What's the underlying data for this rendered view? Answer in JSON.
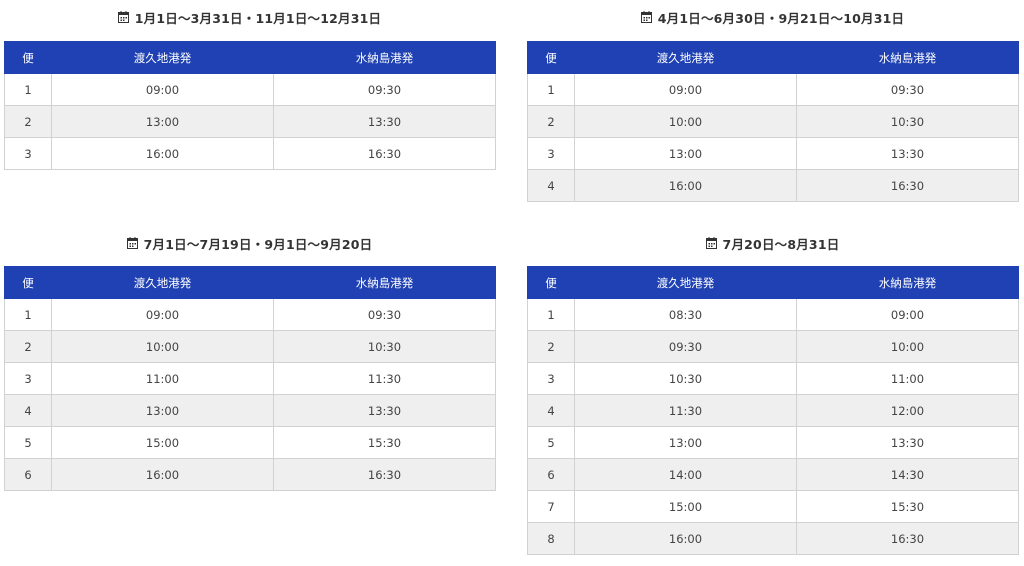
{
  "headers": {
    "col1": "便",
    "col2": "渡久地港発",
    "col3": "水納島港発"
  },
  "panels": [
    {
      "title": "1月1日～3月31日・11月1日～12月31日",
      "rows": [
        {
          "no": "1",
          "a": "09:00",
          "b": "09:30"
        },
        {
          "no": "2",
          "a": "13:00",
          "b": "13:30"
        },
        {
          "no": "3",
          "a": "16:00",
          "b": "16:30"
        }
      ]
    },
    {
      "title": "4月1日～6月30日・9月21日～10月31日",
      "rows": [
        {
          "no": "1",
          "a": "09:00",
          "b": "09:30"
        },
        {
          "no": "2",
          "a": "10:00",
          "b": "10:30"
        },
        {
          "no": "3",
          "a": "13:00",
          "b": "13:30"
        },
        {
          "no": "4",
          "a": "16:00",
          "b": "16:30"
        }
      ]
    },
    {
      "title": "7月1日～7月19日・9月1日～9月20日",
      "rows": [
        {
          "no": "1",
          "a": "09:00",
          "b": "09:30"
        },
        {
          "no": "2",
          "a": "10:00",
          "b": "10:30"
        },
        {
          "no": "3",
          "a": "11:00",
          "b": "11:30"
        },
        {
          "no": "4",
          "a": "13:00",
          "b": "13:30"
        },
        {
          "no": "5",
          "a": "15:00",
          "b": "15:30"
        },
        {
          "no": "6",
          "a": "16:00",
          "b": "16:30"
        }
      ]
    },
    {
      "title": "7月20日～8月31日",
      "rows": [
        {
          "no": "1",
          "a": "08:30",
          "b": "09:00"
        },
        {
          "no": "2",
          "a": "09:30",
          "b": "10:00"
        },
        {
          "no": "3",
          "a": "10:30",
          "b": "11:00"
        },
        {
          "no": "4",
          "a": "11:30",
          "b": "12:00"
        },
        {
          "no": "5",
          "a": "13:00",
          "b": "13:30"
        },
        {
          "no": "6",
          "a": "14:00",
          "b": "14:30"
        },
        {
          "no": "7",
          "a": "15:00",
          "b": "15:30"
        },
        {
          "no": "8",
          "a": "16:00",
          "b": "16:30"
        }
      ]
    }
  ],
  "icons": {
    "heading_icon": "calendar-icon"
  },
  "colors": {
    "header_bg": "#1f41b3",
    "header_text": "#ffffff",
    "alt_row_bg": "#efefef",
    "border": "#d2d2d2"
  }
}
